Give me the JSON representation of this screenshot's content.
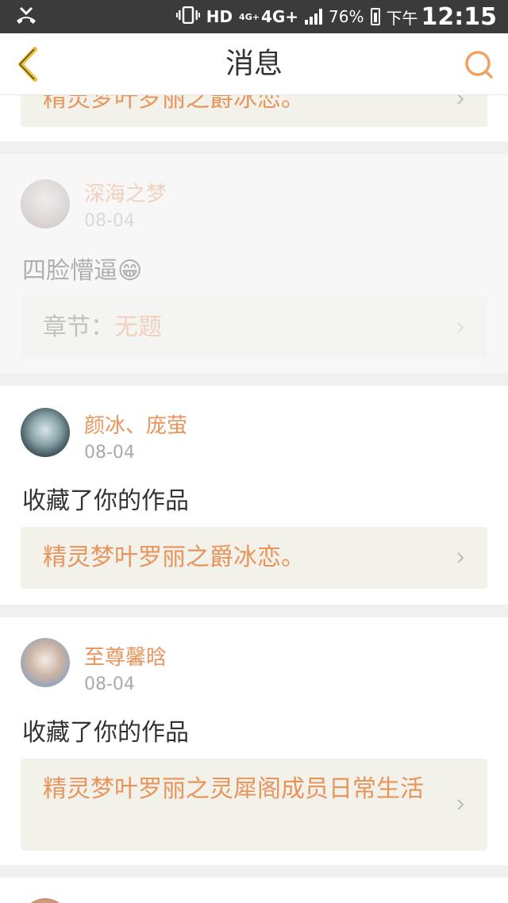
{
  "status_bar": {
    "hd_label": "HD",
    "network_label": "4G+",
    "network_sup": "4G+",
    "battery_percent": "76%",
    "time_prefix": "下午",
    "time": "12:15"
  },
  "header": {
    "title": "消息"
  },
  "messages": [
    {
      "work_title": "精灵梦叶罗丽之爵冰恋。"
    },
    {
      "username": "深海之梦",
      "date": "08-04",
      "text": "四脸懵逼😁",
      "chapter_label": "章节：",
      "chapter_name": "无题"
    },
    {
      "username": "颜冰、庞萤",
      "date": "08-04",
      "text": "收藏了你的作品",
      "work_title": "精灵梦叶罗丽之爵冰恋。"
    },
    {
      "username": "至尊馨晗",
      "date": "08-04",
      "text": "收藏了你的作品",
      "work_title": "精灵梦叶罗丽之灵犀阁成员日常生活"
    }
  ],
  "colors": {
    "accent": "#e8955c",
    "back_arrow": "#f0c030",
    "search_icon": "#f0a060"
  }
}
